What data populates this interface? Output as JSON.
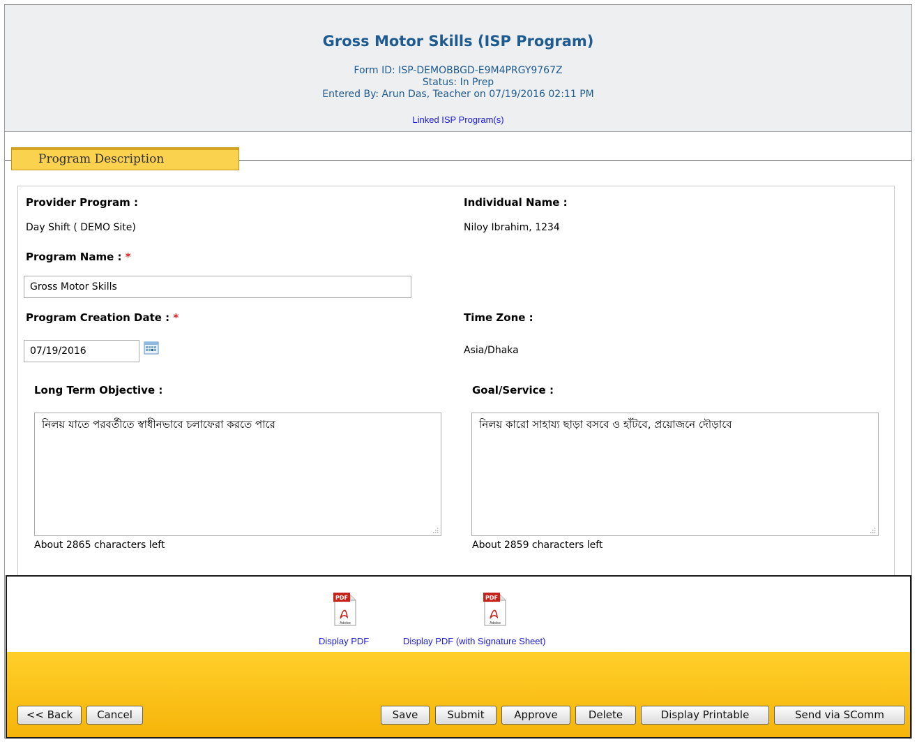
{
  "header": {
    "title": "Gross Motor Skills (ISP Program)",
    "form_id": "Form ID: ISP-DEMOBBGD-E9M4PRGY9767Z",
    "status": "Status: In Prep",
    "entered_by": "Entered By: Arun Das, Teacher  on 07/19/2016 02:11 PM",
    "linked_link": "Linked ISP Program(s)"
  },
  "section": {
    "title": "Program Description"
  },
  "form": {
    "provider_program_label": "Provider Program :",
    "provider_program_value": "Day Shift ( DEMO Site)",
    "individual_name_label": "Individual Name :",
    "individual_name_value": "Niloy Ibrahim, 1234",
    "program_name_label": "Program Name :",
    "program_name_value": "Gross Motor Skills",
    "creation_date_label": "Program Creation Date :",
    "creation_date_value": "07/19/2016",
    "time_zone_label": "Time Zone :",
    "time_zone_value": "Asia/Dhaka",
    "required_mark": "*",
    "long_term_label": "Long Term Objective :",
    "long_term_value": "নিলয় যাতে পরবর্তীতে স্বাধীনভাবে চলাফেরা করতে পারে",
    "long_term_counter": "About 2865 characters left",
    "goal_label": "Goal/Service :",
    "goal_value": "নিলয় কারো সাহায্য ছাড়া বসবে ও হাঁটবে, প্রয়োজনে দৌড়াবে",
    "goal_counter": "About 2859 characters left"
  },
  "pdf": {
    "display_pdf": "Display PDF",
    "display_pdf_sig": "Display PDF (with Signature Sheet)",
    "icon_text": "PDF",
    "icon_brand": "Adobe"
  },
  "buttons": {
    "back": "<< Back",
    "cancel": "Cancel",
    "save": "Save",
    "submit": "Submit",
    "approve": "Approve",
    "delete": "Delete",
    "display_printable": "Display Printable",
    "send_scomm": "Send via SComm"
  },
  "colors": {
    "title_blue": "#1e5b91",
    "link_blue": "#1a1adb",
    "tab_yellow": "#fbd24e",
    "footer_yellow": "#f9c31a",
    "required_red": "#e02020"
  }
}
